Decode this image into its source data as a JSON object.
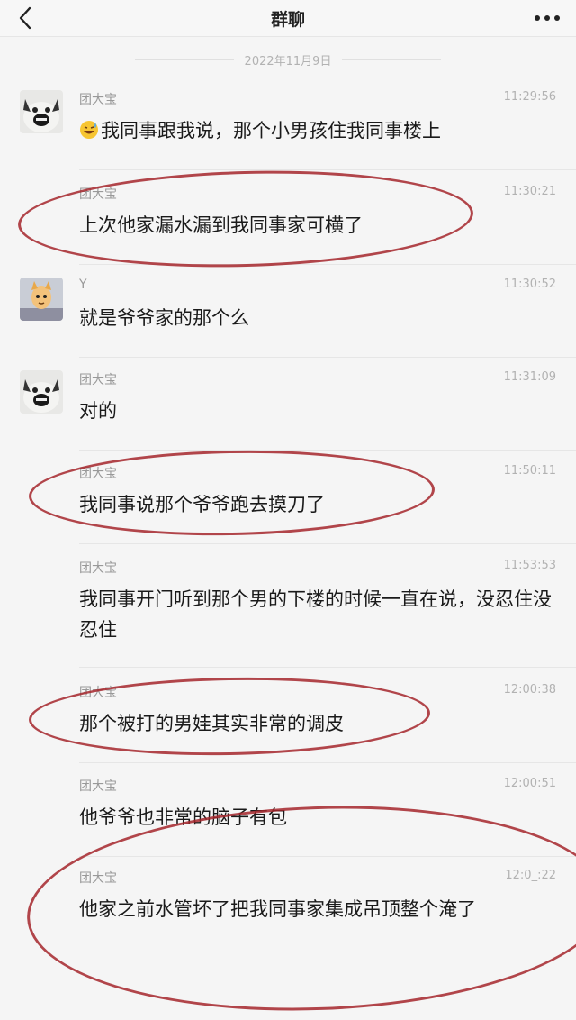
{
  "header": {
    "title": "群聊",
    "back_icon": "chevron-left-icon",
    "more_icon": "more-dots-icon"
  },
  "date_divider": "2022年11月9日",
  "messages": [
    {
      "sender": "团大宝",
      "time": "11:29:56",
      "text": "我同事跟我说，那个小男孩住我同事楼上",
      "emoji": "grinning-sweat-emoji",
      "avatar": "dog-avatar"
    },
    {
      "sender": "团大宝",
      "time": "11:30:21",
      "text": "上次他家漏水漏到我同事家可横了"
    },
    {
      "sender": "Y",
      "time": "11:30:52",
      "text": "就是爷爷家的那个么",
      "avatar": "cartoon-avatar"
    },
    {
      "sender": "团大宝",
      "time": "11:31:09",
      "text": "对的",
      "avatar": "dog-avatar"
    },
    {
      "sender": "团大宝",
      "time": "11:50:11",
      "text": "我同事说那个爷爷跑去摸刀了"
    },
    {
      "sender": "团大宝",
      "time": "11:53:53",
      "text": "我同事开门听到那个男的下楼的时候一直在说，没忍住没忍住"
    },
    {
      "sender": "团大宝",
      "time": "12:00:38",
      "text": "那个被打的男娃其实非常的调皮"
    },
    {
      "sender": "团大宝",
      "time": "12:00:51",
      "text": "他爷爷也非常的脑子有包"
    },
    {
      "sender": "团大宝",
      "time": "12:0_:22",
      "text": "他家之前水管坏了把我同事家集成吊顶整个淹了"
    }
  ],
  "colors": {
    "annotation": "#a4262c",
    "timestamp": "#b2b2b2",
    "sender": "#999999"
  }
}
